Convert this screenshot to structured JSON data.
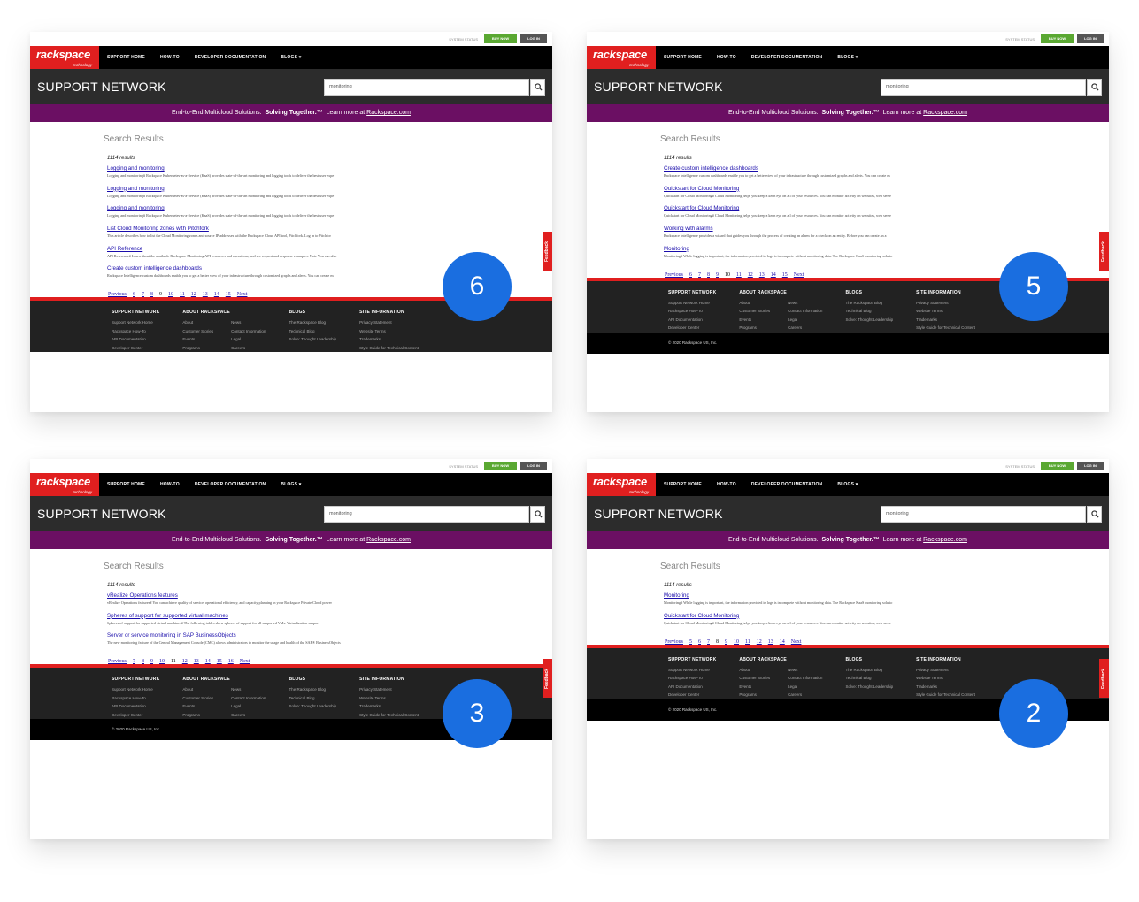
{
  "site": {
    "util": {
      "status": "SYSTEM STATUS",
      "buy": "BUY NOW",
      "login": "LOG IN"
    },
    "logo": {
      "word": "rackspace",
      "tag": "technology"
    },
    "nav": [
      "SUPPORT HOME",
      "HOW-TO",
      "DEVELOPER DOCUMENTATION",
      "BLOGS ▾"
    ],
    "title": "SUPPORT NETWORK",
    "search_value": "monitoring",
    "promo": {
      "a": "End-to-End Multicloud Solutions.",
      "b": "Solving Together.™",
      "c": "Learn more at",
      "link": "Rackspace.com"
    },
    "results_heading": "Search Results",
    "results_count": "1114 results",
    "prev": "Previous",
    "next": "Next",
    "feedback": "Feedback",
    "footer": {
      "support": {
        "title": "SUPPORT NETWORK",
        "links": [
          "Support Network Home",
          "Rackspace How-To",
          "API Documentation",
          "Developer Center"
        ]
      },
      "about": {
        "title": "ABOUT RACKSPACE",
        "left": [
          "About",
          "Customer Stories",
          "Events",
          "Programs"
        ],
        "right": [
          "News",
          "Contact Information",
          "Legal",
          "Careers"
        ]
      },
      "blogs": {
        "title": "BLOGS",
        "links": [
          "The Rackspace Blog",
          "Technical Blog",
          "Solve: Thought Leadership"
        ]
      },
      "site": {
        "title": "SITE INFORMATION",
        "links": [
          "Privacy Statement",
          "Website Terms",
          "Trademarks",
          "Style Guide for Technical Content"
        ]
      }
    },
    "copyright": "© 2020 Rackspace US, Inc."
  },
  "panels": [
    {
      "badge": "6",
      "results": [
        {
          "title": "Logging and monitoring",
          "desc": "Logging and monitoring# Rackspace Kubernetes-as-a-Service (KaaS) provides state-of-the-art monitoring and logging tools to deliver the best user expe"
        },
        {
          "title": "Logging and monitoring",
          "desc": "Logging and monitoring# Rackspace Kubernetes-as-a-Service (KaaS) provides state-of-the-art monitoring and logging tools to deliver the best user expe"
        },
        {
          "title": "Logging and monitoring",
          "desc": "Logging and monitoring# Rackspace Kubernetes-as-a-Service (KaaS) provides state-of-the-art monitoring and logging tools to deliver the best user expe"
        },
        {
          "title": "List Cloud Monitoring zones with Pitchfork",
          "desc": "This article describes how to list the Cloud Monitoring zones and source IP addresses with the Rackspace Cloud API tool, Pitchfork. Log in to Pitchfor"
        },
        {
          "title": "API Reference",
          "desc": "API Reference# Learn about the available Rackspace Monitoring API resources and operations, and see request and response examples. Note You can also"
        },
        {
          "title": "Create custom intelligence dashboards",
          "desc": "Rackspace Intelligence custom dashboards enable you to get a better view of your infrastructure through customized graphs and alerts. You can create m"
        }
      ],
      "pages": [
        "6",
        "7",
        "8",
        "9",
        "10",
        "11",
        "12",
        "13",
        "14",
        "15"
      ],
      "current": "9"
    },
    {
      "badge": "5",
      "results": [
        {
          "title": "Create custom intelligence dashboards",
          "desc": "Rackspace Intelligence custom dashboards enable you to get a better view of your infrastructure through customized graphs and alerts. You can create m"
        },
        {
          "title": "Quickstart for Cloud Monitoring",
          "desc": "Quickstart for Cloud Monitoring# Cloud Monitoring helps you keep a keen eye on all of your resources. You can monitor activity on websites, web serve"
        },
        {
          "title": "Quickstart for Cloud Monitoring",
          "desc": "Quickstart for Cloud Monitoring# Cloud Monitoring helps you keep a keen eye on all of your resources. You can monitor activity on websites, web serve"
        },
        {
          "title": "Working with alarms",
          "desc": "Rackspace Intelligence provides a wizard that guides you through the process of creating an alarm for a check on an entity. Before you can create an a"
        },
        {
          "title": "Monitoring",
          "desc": "Monitoring# While logging is important, the information provided in logs is incomplete without monitoring data. The Rackspace KaaS monitoring solutio"
        }
      ],
      "pages": [
        "6",
        "7",
        "8",
        "9",
        "10",
        "11",
        "12",
        "13",
        "14",
        "15"
      ],
      "current": "10"
    },
    {
      "badge": "3",
      "results": [
        {
          "title": "vRealize Operations features",
          "desc": "vRealize Operations features# You can achieve quality of service, operational efficiency, and capacity planning in your Rackspace Private Cloud power"
        },
        {
          "title": "Spheres of support for supported virtual machines",
          "desc": "Spheres of support for supported virtual machines# The following tables show spheres of support for all supported VMs. Virtualization support"
        },
        {
          "title": "Server or service monitoring in SAP BusinessObjects",
          "desc": "The new monitoring feature of the Central Management Console (CMC) allows administrators to monitor the usage and health of the SAP® BusinessObjects i"
        }
      ],
      "pages": [
        "7",
        "8",
        "9",
        "10",
        "11",
        "12",
        "13",
        "14",
        "15",
        "16"
      ],
      "current": "11"
    },
    {
      "badge": "2",
      "results": [
        {
          "title": "Monitoring",
          "desc": "Monitoring# While logging is important, the information provided in logs is incomplete without monitoring data. The Rackspace KaaS monitoring solutio"
        },
        {
          "title": "Quickstart for Cloud Monitoring",
          "desc": "Quickstart for Cloud Monitoring# Cloud Monitoring helps you keep a keen eye on all of your resources. You can monitor activity on websites, web serve"
        }
      ],
      "pages": [
        "5",
        "6",
        "7",
        "8",
        "9",
        "10",
        "11",
        "12",
        "13",
        "14"
      ],
      "current": "8"
    }
  ]
}
